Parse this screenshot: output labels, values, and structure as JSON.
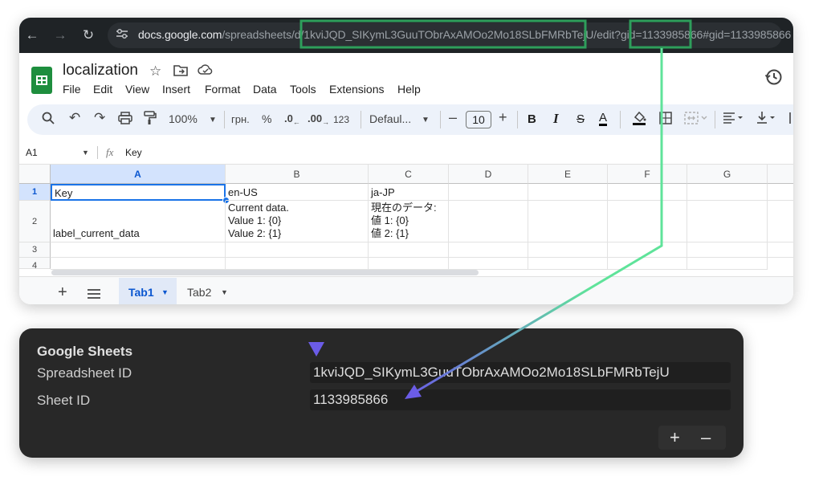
{
  "browser": {
    "url_host": "docs.google.com",
    "url_path_prefix": "/spreadsheets/d/",
    "url_id": "1kviJQD_SIKymL3GuuTObrAxAMOo2Mo18SLbFMRbTejU",
    "url_edit": "/edit?gid=",
    "url_gid": "1133985866",
    "url_hash": "#gid=1133985866"
  },
  "sheets": {
    "title": "localization",
    "menu": [
      "File",
      "Edit",
      "View",
      "Insert",
      "Format",
      "Data",
      "Tools",
      "Extensions",
      "Help"
    ],
    "toolbar": {
      "zoom": "100%",
      "currency": "грн.",
      "percent": "%",
      "dec_decrease": ".0",
      "dec_increase": ".00",
      "number_format": "123",
      "font": "Defaul...",
      "font_size": "10"
    },
    "name_box": "A1",
    "formula": "Key",
    "columns": [
      "A",
      "B",
      "C",
      "D",
      "E",
      "F",
      "G"
    ],
    "rows": [
      "1",
      "2",
      "3",
      "4"
    ],
    "cells": {
      "a1": "Key",
      "b1": "en-US",
      "c1": "ja-JP",
      "a2": "label_current_data",
      "b2": [
        "Current data.",
        "Value 1: {0}",
        "Value 2: {1}"
      ],
      "c2": [
        "現在のデータ:",
        "値 1: {0}",
        "値 2: {1}"
      ]
    },
    "tabs": [
      "Tab1",
      "Tab2"
    ]
  },
  "panel": {
    "heading": "Google Sheets",
    "spreadsheet_label": "Spreadsheet ID",
    "spreadsheet_value": "1kviJQD_SIKymL3GuuTObrAxAMOo2Mo18SLbFMRbTejU",
    "sheet_label": "Sheet ID",
    "sheet_value": "1133985866"
  },
  "colors": {
    "highlight": "#2e9e5b",
    "arrow_green": "#5fe39a",
    "arrow_purple": "#6b5ce7"
  }
}
